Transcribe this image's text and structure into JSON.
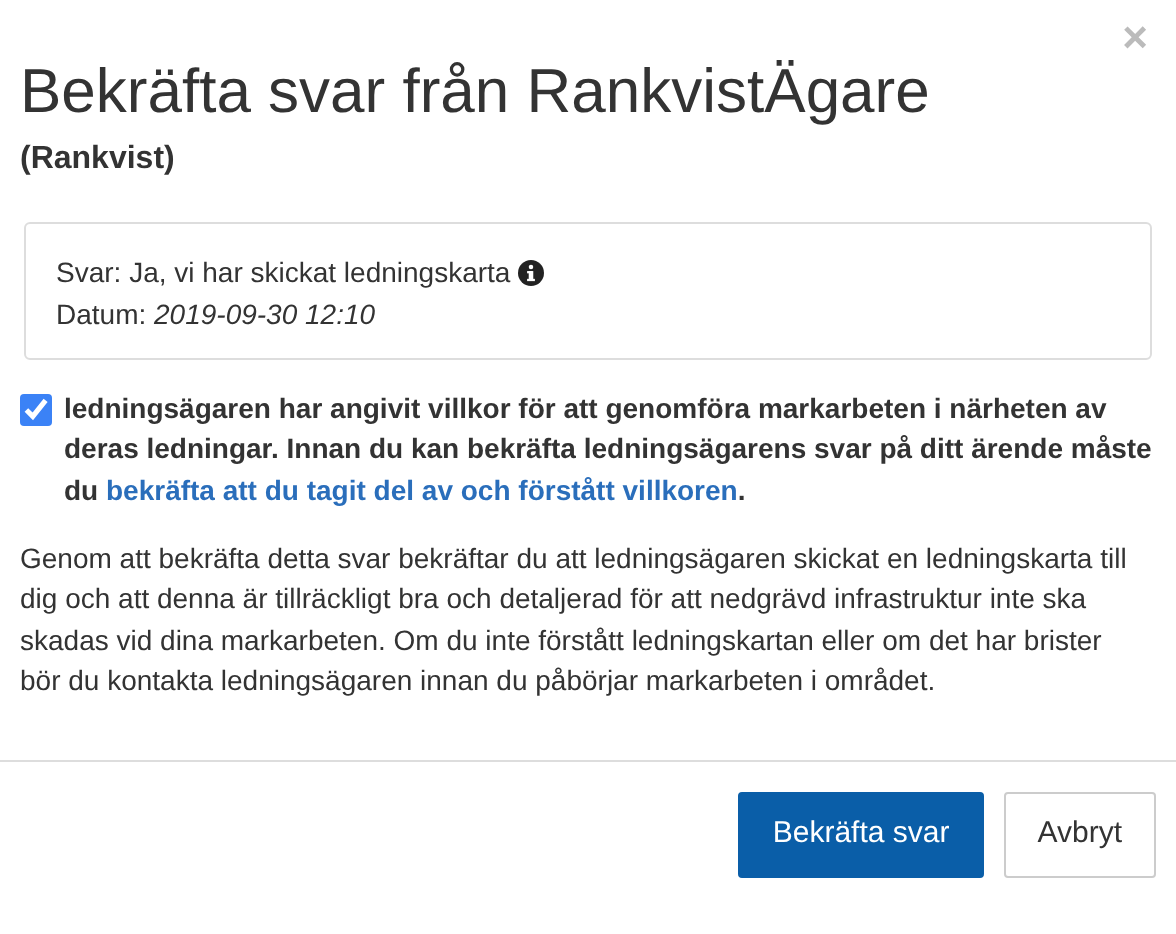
{
  "close": "×",
  "title": "Bekräfta svar från RankvistÄgare",
  "subtitle": "(Rankvist)",
  "answer": {
    "label": "Svar:",
    "value": "Ja, vi har skickat ledningskarta",
    "date_label": "Datum:",
    "date": "2019-09-30 12:10"
  },
  "consent": {
    "checked": true,
    "text": "ledningsägaren har angivit villkor för att genomföra markarbeten i närheten av deras ledningar. Innan du kan bekräfta ledningsägarens svar på ditt ärende måste du ",
    "link": "bekräfta att du tagit del av och förstått villkoren",
    "after": "."
  },
  "info": "Genom att bekräfta detta svar bekräftar du att ledningsägaren skickat en ledningskarta till dig och att denna är tillräckligt bra och detaljerad för att nedgrävd infrastruktur inte ska skadas vid dina markarbeten. Om du inte förstått ledningskartan eller om det har brister bör du kontakta ledningsägaren innan du påbörjar markarbeten i området.",
  "buttons": [
    {
      "label": "Bekräfta svar",
      "kind": "primary"
    },
    {
      "label": "Avbryt",
      "kind": "secondary"
    }
  ]
}
